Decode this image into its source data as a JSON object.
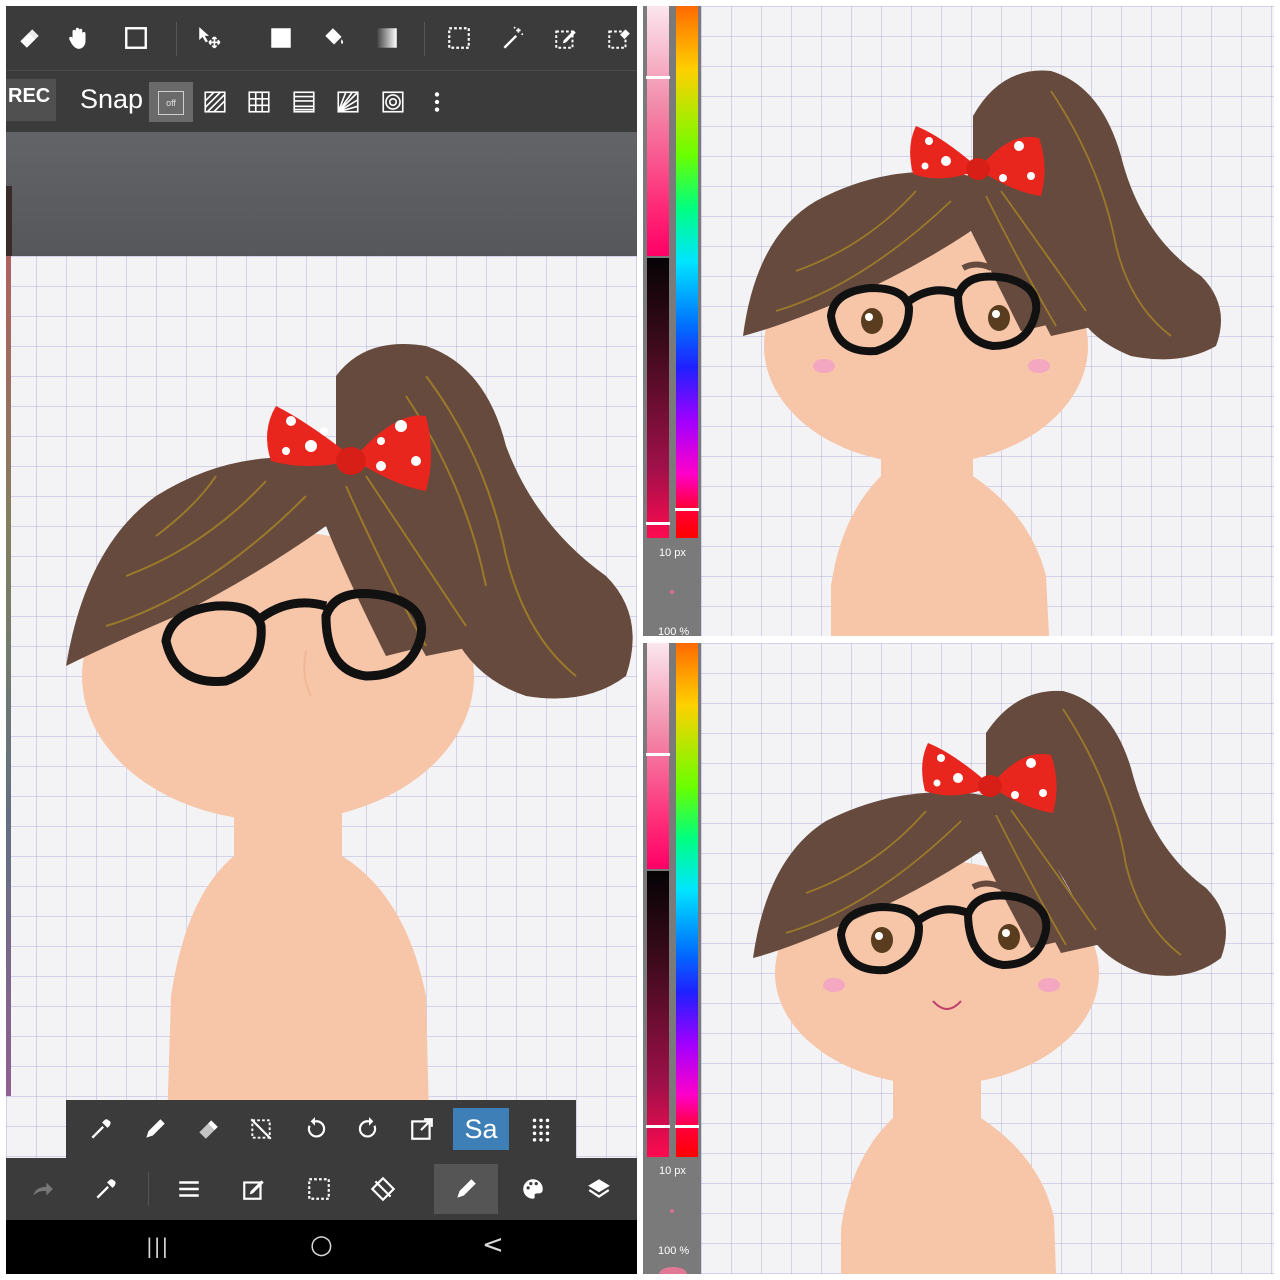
{
  "colors": {
    "toolbar_bg": "#3b3b3b",
    "toolbar_bg_dark": "#2a2a2a",
    "accent_blue": "#3d7fb6",
    "hair": "#654a3d",
    "hair_strands": "#9a7a2a",
    "skin": "#f7c5a8",
    "bow": "#e8261e",
    "glasses": "#111111",
    "blush": "#f4a7c0"
  },
  "left_panel": {
    "top_toolbar": {
      "tools": [
        {
          "name": "eraser-icon"
        },
        {
          "name": "hand-icon"
        },
        {
          "name": "rectangle-icon"
        },
        {
          "name": "move-icon"
        },
        {
          "name": "fill-rect-icon"
        },
        {
          "name": "bucket-icon"
        },
        {
          "name": "gradient-icon"
        },
        {
          "name": "select-rect-icon"
        },
        {
          "name": "magic-wand-icon"
        },
        {
          "name": "select-pen-icon"
        },
        {
          "name": "select-eraser-icon"
        }
      ]
    },
    "snap_bar": {
      "rec_label": "REC",
      "snap_label": "Snap",
      "snap_off_label": "off",
      "icons": [
        "parallel-snap-icon",
        "grid-snap-icon",
        "perspective-snap-icon",
        "radial-snap-icon",
        "circle-snap-icon",
        "more-icon"
      ]
    },
    "quick_bar": {
      "icons": [
        "eyedropper-icon",
        "pen-icon",
        "eraser-icon",
        "deselect-icon",
        "undo-icon",
        "redo-icon",
        "export-icon"
      ],
      "sa_label": "Sa",
      "grid_icon": "dots-grid-icon"
    },
    "bottom_bar": {
      "icons": [
        "redo-arrow-icon",
        "eyedropper-icon",
        "menu-icon",
        "edit-icon",
        "selection-icon",
        "transform-icon",
        "brush-icon",
        "palette-icon",
        "layers-icon"
      ]
    },
    "nav_bar": {
      "recent": "|||",
      "home": "○",
      "back": "<"
    }
  },
  "top_right_panel": {
    "brush_size": "10 px",
    "opacity": "100 %"
  },
  "bottom_right_panel": {
    "brush_size": "10 px",
    "opacity": "100 %"
  }
}
